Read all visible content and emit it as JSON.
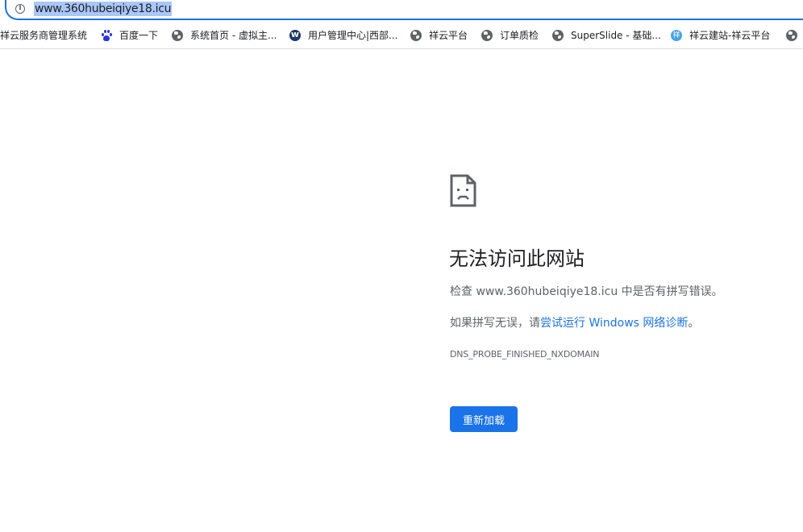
{
  "address_bar": {
    "url": "www.360hubeiqiye18.icu",
    "info_icon": "info-icon"
  },
  "bookmarks": [
    {
      "label": "祥云服务商管理系统",
      "icon": "none"
    },
    {
      "label": "百度一下",
      "icon": "baidu-paw-icon"
    },
    {
      "label": "系统首页 - 虚拟主...",
      "icon": "globe-icon"
    },
    {
      "label": "用户管理中心|西部...",
      "icon": "west-digital-icon"
    },
    {
      "label": "祥云平台",
      "icon": "globe-icon"
    },
    {
      "label": "订单质检",
      "icon": "globe-icon"
    },
    {
      "label": "SuperSlide - 基础...",
      "icon": "globe-icon"
    },
    {
      "label": "祥云建站-祥云平台",
      "icon": "xiangyun-icon"
    },
    {
      "label": "",
      "icon": "globe-icon"
    }
  ],
  "error": {
    "icon": "sad-page-icon",
    "title": "无法访问此网站",
    "line1": "检查 www.360hubeiqiye18.icu 中是否有拼写错误。",
    "line2_prefix": "如果拼写无误，请",
    "line2_link": "尝试运行 Windows 网络诊断",
    "line2_suffix": "。",
    "code": "DNS_PROBE_FINISHED_NXDOMAIN",
    "reload_label": "重新加载"
  },
  "colors": {
    "accent": "#1a73e8",
    "selection": "#a8c7fa",
    "text_secondary": "#5f6368"
  }
}
